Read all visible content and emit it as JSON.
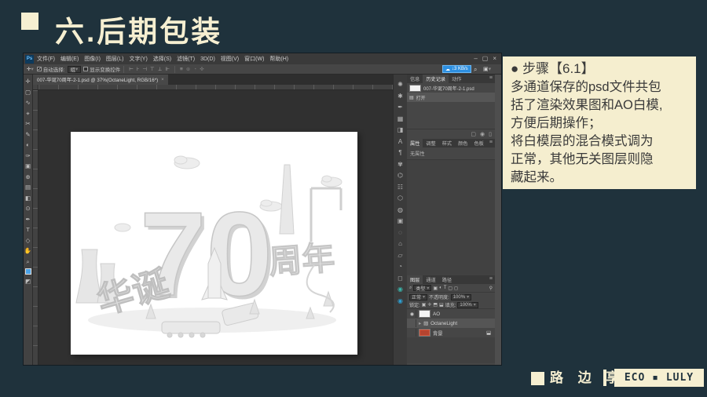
{
  "slide": {
    "title": "六.后期包装",
    "background_color": "#1f323c",
    "accent_cream": "#f6efd1"
  },
  "note": {
    "heading": "●  步骤【6.1】",
    "body": "多通道保存的psd文件共包\n括了渲染效果图和AO白模,\n方便后期操作；\n将白模层的混合模式调为\n正常，其他无关图层则隐\n藏起来。"
  },
  "footer": {
    "brand_cn": "路 边 享",
    "brand_en": "ECO ▪ LULY"
  },
  "photoshop": {
    "menu": [
      "文件(F)",
      "编辑(E)",
      "图像(I)",
      "图层(L)",
      "文字(Y)",
      "选择(S)",
      "滤镜(T)",
      "3D(D)",
      "视图(V)",
      "窗口(W)",
      "帮助(H)"
    ],
    "logo": "Ps",
    "window_controls": {
      "minimize": "–",
      "maximize": "▢",
      "close": "×"
    },
    "options": {
      "auto_select_label": "自动选择:",
      "auto_select_value": "组",
      "show_transform_label": "显示变换控件",
      "network_badge": "↓3 KB/s"
    },
    "doc_tab": {
      "title": "007-华诞70周年-2-1.psd @ 37%(OctaneLight, RGB/16*)",
      "close": "×"
    },
    "zoom_percent": "37%",
    "history_panel": {
      "tabs": [
        "信息",
        "历史记录",
        "动作"
      ],
      "entries": [
        {
          "label": "007-华诞70周年-2-1.psd"
        },
        {
          "label": "打开"
        }
      ]
    },
    "properties_panel": {
      "tabs": [
        "属性",
        "调整",
        "样式",
        "颜色",
        "色板"
      ],
      "empty_text": "无属性"
    },
    "layers_panel": {
      "tabs": [
        "图层",
        "通道",
        "路径"
      ],
      "filter_label": "类型",
      "blend_mode": "正常",
      "opacity_label": "不透明度:",
      "opacity_value": "100%",
      "lock_label": "锁定:",
      "fill_label": "填充:",
      "fill_value": "100%",
      "layers": [
        {
          "name": "AO",
          "visible": true,
          "thumb": "white"
        },
        {
          "name": "OctaneLight",
          "group": true,
          "selected": true,
          "visible": false
        },
        {
          "name": "背景",
          "locked": true,
          "thumb": "red",
          "visible": false
        }
      ]
    },
    "canvas_art": {
      "numeral": "70",
      "left_text": "华诞",
      "right_text": "周年",
      "description": "AO white clay 3D render"
    },
    "tool_icons": [
      "move",
      "marquee",
      "lasso",
      "quick-select",
      "crop",
      "frame",
      "eyedropper",
      "healing",
      "brush",
      "clone-stamp",
      "history-brush",
      "eraser",
      "gradient",
      "blur",
      "dodge",
      "pen",
      "type",
      "path-select",
      "shape",
      "hand",
      "zoom"
    ]
  }
}
